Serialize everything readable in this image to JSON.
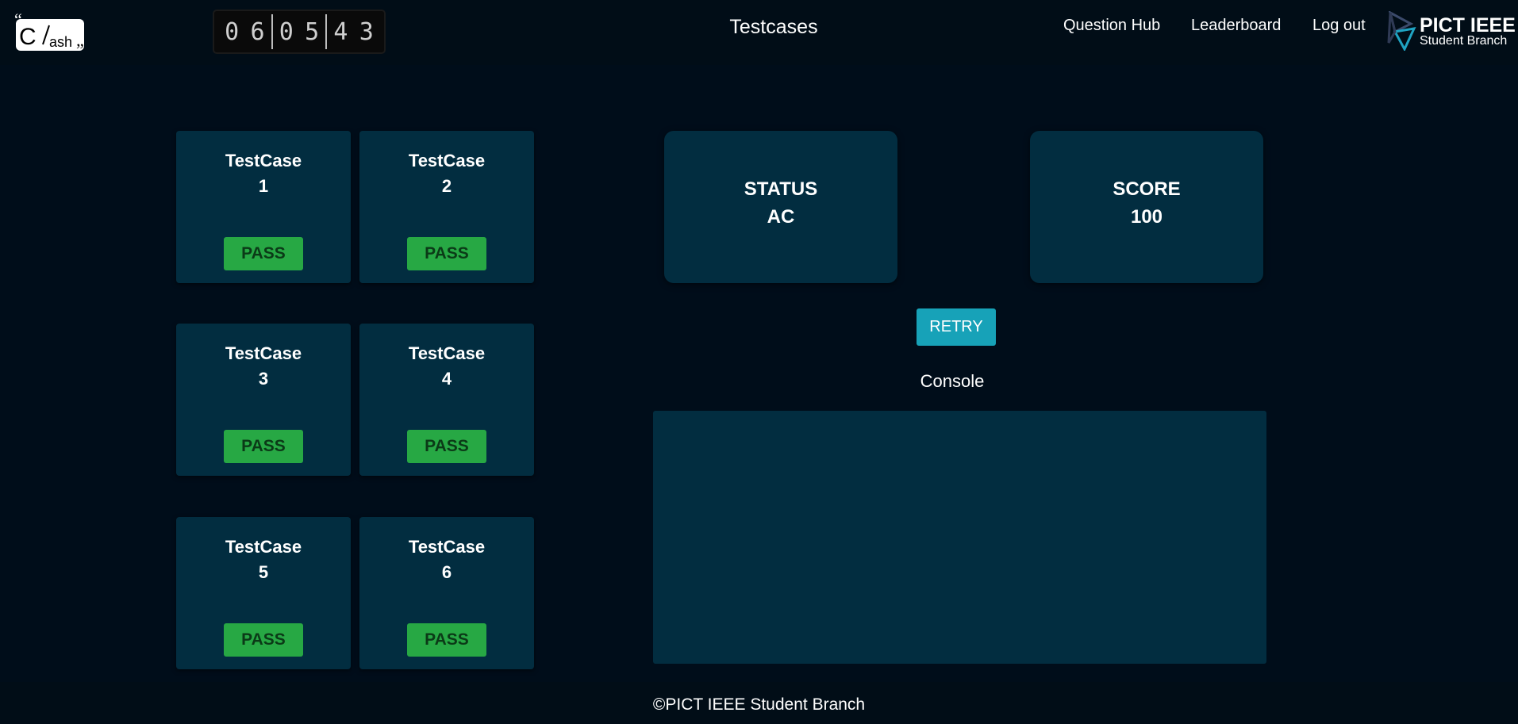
{
  "header": {
    "logo_text": "Clash",
    "timer": {
      "digits": [
        "0",
        "6",
        "0",
        "5",
        "4",
        "3"
      ]
    },
    "page_title": "Testcases",
    "nav": {
      "question_hub": "Question Hub",
      "leaderboard": "Leaderboard",
      "logout": "Log out"
    },
    "partner_logo": {
      "title": "PICT IEEE",
      "subtitle": "Student Branch"
    }
  },
  "testcases": [
    {
      "label": "TestCase",
      "number": "1",
      "result": "PASS"
    },
    {
      "label": "TestCase",
      "number": "2",
      "result": "PASS"
    },
    {
      "label": "TestCase",
      "number": "3",
      "result": "PASS"
    },
    {
      "label": "TestCase",
      "number": "4",
      "result": "PASS"
    },
    {
      "label": "TestCase",
      "number": "5",
      "result": "PASS"
    },
    {
      "label": "TestCase",
      "number": "6",
      "result": "PASS"
    }
  ],
  "status": {
    "label": "STATUS",
    "value": "AC"
  },
  "score": {
    "label": "SCORE",
    "value": "100"
  },
  "retry_label": "RETRY",
  "console": {
    "label": "Console",
    "output": ""
  },
  "footer": {
    "text": "©PICT IEEE Student Branch"
  },
  "colors": {
    "background": "#000d1a",
    "card": "#022d40",
    "pass": "#27a844",
    "retry": "#17a2b8"
  }
}
